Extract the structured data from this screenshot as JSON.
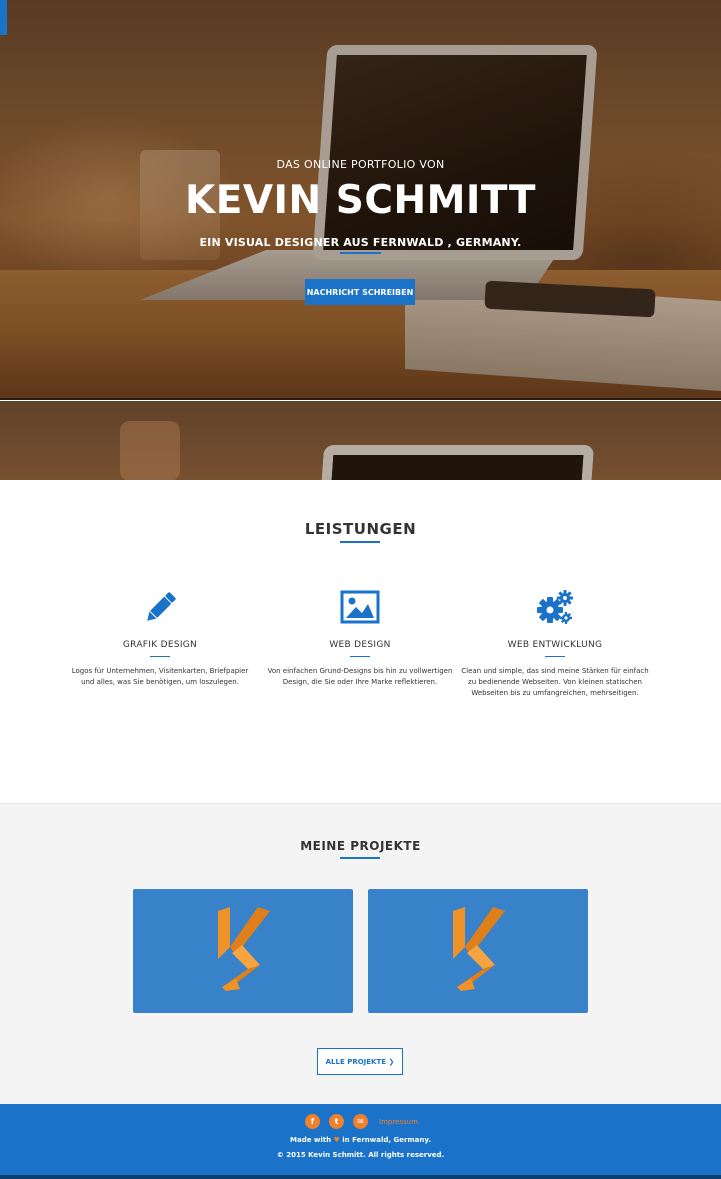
{
  "hero": {
    "kicker": "DAS ONLINE PORTFOLIO VON",
    "title": "KEVIN SCHMITT",
    "subtitle": "EIN VISUAL DESIGNER AUS FERNWALD , GERMANY.",
    "button_label": "NACHRICHT SCHREIBEN"
  },
  "services": {
    "title": "LEISTUNGEN",
    "items": [
      {
        "icon": "pencil-icon",
        "name": "GRAFIK DESIGN",
        "desc": "Logos für Unternehmen, Visitenkarten, Briefpapier und alles, was Sie benötigen, um loszulegen."
      },
      {
        "icon": "image-icon",
        "name": "WEB DESIGN",
        "desc": "Von einfachen Grund-Designs bis hin zu vollwertigen Design, die Sie oder Ihre Marke reflektieren."
      },
      {
        "icon": "gears-icon",
        "name": "WEB ENTWICKLUNG",
        "desc": "Clean und simple, das sind meine Stärken für einfach zu bedienende Webseiten. Von kleinen statischen Webseiten bis zu umfangreichen, mehrseitigen."
      }
    ]
  },
  "projects": {
    "title": "MEINE PROJEKTE",
    "cards": [
      {
        "logo": "ks-logo"
      },
      {
        "logo": "ks-logo"
      }
    ],
    "all_button_label": "ALLE PROJEKTE ❯"
  },
  "footer": {
    "social": [
      {
        "icon": "facebook-icon",
        "glyph": "f"
      },
      {
        "icon": "twitter-icon",
        "glyph": "t"
      },
      {
        "icon": "mail-icon",
        "glyph": "✉"
      }
    ],
    "impressum_label": "Impressum",
    "made_prefix": "Made with ",
    "heart": "♥",
    "made_suffix": " in Fernwald, Germany.",
    "copyright": "© 2015 Kevin Schmitt. All rights reserved."
  },
  "colors": {
    "accent": "#1a73c8",
    "project_card": "#3782c8",
    "logo_orange": "#f0922a",
    "footer_icon": "#f0802a"
  }
}
